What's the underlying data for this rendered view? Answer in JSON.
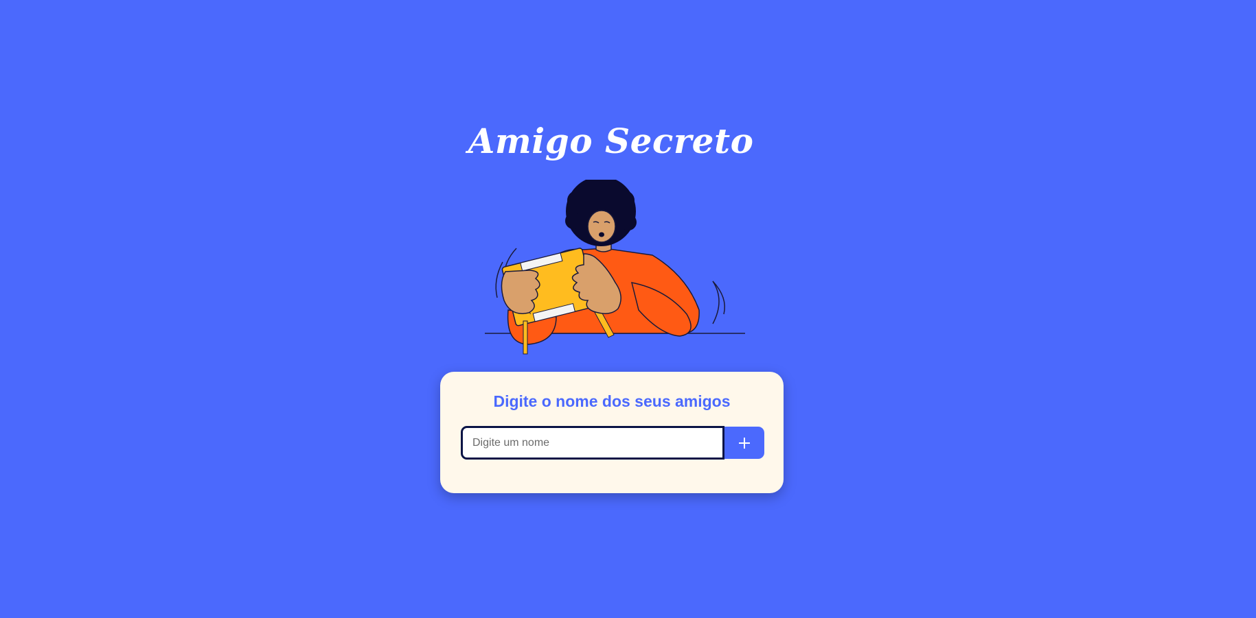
{
  "page": {
    "background_color": "#4b69fd",
    "title": "Amigo Secreto"
  },
  "illustration": {
    "icon": "person-shaking-gift-box-illustration"
  },
  "card": {
    "background_color": "#fff8eb",
    "heading": "Digite o nome dos seus amigos",
    "heading_color": "#4b69fd",
    "name_input": {
      "value": "",
      "placeholder": "Digite um nome"
    },
    "add_button": {
      "icon": "plus-icon",
      "color": "#4b69fd"
    }
  }
}
